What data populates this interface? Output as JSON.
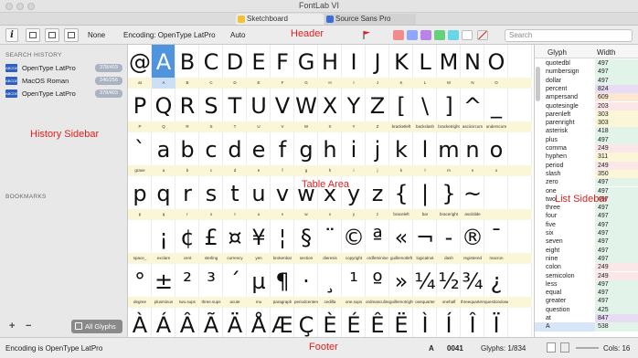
{
  "window": {
    "title": "FontLab VI"
  },
  "tabs": [
    {
      "label": "Sketchboard"
    },
    {
      "label": "Source Sans Pro"
    }
  ],
  "toolbar": {
    "info": "i",
    "none_label": "None",
    "encoding_label": "Encoding: OpenType LatPro",
    "auto_label": "Auto",
    "search_placeholder": "Search",
    "swatch_colors": [
      "#f28b8b",
      "#8fa6ff",
      "#b884e8",
      "#66d17a",
      "#66d6e8",
      "#ffffff"
    ]
  },
  "annotations": {
    "header": "Header",
    "history_sidebar": "History Sidebar",
    "table_area": "Table Area",
    "list_sidebar": "List Sidebar",
    "footer": "Footer"
  },
  "sidebar": {
    "search_history_title": "SEARCH HISTORY",
    "history": [
      {
        "icon": "ABCDE",
        "label": "OpenType LatPro",
        "badge": "378/403"
      },
      {
        "icon": "ABCDE",
        "label": "MacOS Roman",
        "badge": "246/256"
      },
      {
        "icon": "ABCDE",
        "label": "OpenType LatPro",
        "badge": "378/403"
      }
    ],
    "bookmarks_title": "BOOKMARKS",
    "plus": "+",
    "minus": "−",
    "all_glyphs": "All Glyphs"
  },
  "grid": {
    "rows": [
      {
        "cells": [
          {
            "g": "@",
            "n": "at"
          },
          {
            "g": "A",
            "n": "A"
          },
          {
            "g": "B",
            "n": "B"
          },
          {
            "g": "C",
            "n": "C"
          },
          {
            "g": "D",
            "n": "D"
          },
          {
            "g": "E",
            "n": "E"
          },
          {
            "g": "F",
            "n": "F"
          },
          {
            "g": "G",
            "n": "G"
          },
          {
            "g": "H",
            "n": "H"
          },
          {
            "g": "I",
            "n": "I"
          },
          {
            "g": "J",
            "n": "J"
          },
          {
            "g": "K",
            "n": "K"
          },
          {
            "g": "L",
            "n": "L"
          },
          {
            "g": "M",
            "n": "M"
          },
          {
            "g": "N",
            "n": "N"
          },
          {
            "g": "O",
            "n": "O"
          },
          {
            "g": "",
            "n": ""
          }
        ]
      },
      {
        "cells": [
          {
            "g": "P",
            "n": "P"
          },
          {
            "g": "Q",
            "n": "Q"
          },
          {
            "g": "R",
            "n": "R"
          },
          {
            "g": "S",
            "n": "S"
          },
          {
            "g": "T",
            "n": "T"
          },
          {
            "g": "U",
            "n": "U"
          },
          {
            "g": "V",
            "n": "V"
          },
          {
            "g": "W",
            "n": "W"
          },
          {
            "g": "X",
            "n": "X"
          },
          {
            "g": "Y",
            "n": "Y"
          },
          {
            "g": "Z",
            "n": "Z"
          },
          {
            "g": "[",
            "n": "bracketleft"
          },
          {
            "g": "\\",
            "n": "backslash"
          },
          {
            "g": "]",
            "n": "bracketright"
          },
          {
            "g": "^",
            "n": "asciicircum"
          },
          {
            "g": "_",
            "n": "underscore"
          },
          {
            "g": "",
            "n": ""
          }
        ]
      },
      {
        "cells": [
          {
            "g": "`",
            "n": "grave"
          },
          {
            "g": "a",
            "n": "a"
          },
          {
            "g": "b",
            "n": "b"
          },
          {
            "g": "c",
            "n": "c"
          },
          {
            "g": "d",
            "n": "d"
          },
          {
            "g": "e",
            "n": "e"
          },
          {
            "g": "f",
            "n": "f"
          },
          {
            "g": "g",
            "n": "g"
          },
          {
            "g": "h",
            "n": "h"
          },
          {
            "g": "i",
            "n": "i"
          },
          {
            "g": "j",
            "n": "j"
          },
          {
            "g": "k",
            "n": "k"
          },
          {
            "g": "l",
            "n": "l"
          },
          {
            "g": "m",
            "n": "m"
          },
          {
            "g": "n",
            "n": "n"
          },
          {
            "g": "o",
            "n": "o"
          },
          {
            "g": "",
            "n": ""
          }
        ]
      },
      {
        "cells": [
          {
            "g": "p",
            "n": "p"
          },
          {
            "g": "q",
            "n": "q"
          },
          {
            "g": "r",
            "n": "r"
          },
          {
            "g": "s",
            "n": "s"
          },
          {
            "g": "t",
            "n": "t"
          },
          {
            "g": "u",
            "n": "u"
          },
          {
            "g": "v",
            "n": "v"
          },
          {
            "g": "w",
            "n": "w"
          },
          {
            "g": "x",
            "n": "x"
          },
          {
            "g": "y",
            "n": "y"
          },
          {
            "g": "z",
            "n": "z"
          },
          {
            "g": "{",
            "n": "braceleft"
          },
          {
            "g": "|",
            "n": "bar"
          },
          {
            "g": "}",
            "n": "braceright"
          },
          {
            "g": "~",
            "n": "asciitilde"
          },
          {
            "g": "",
            "n": ""
          },
          {
            "g": "",
            "n": ""
          }
        ]
      },
      {
        "cells": [
          {
            "g": "",
            "n": "space_"
          },
          {
            "g": "¡",
            "n": "exclam"
          },
          {
            "g": "¢",
            "n": "cent"
          },
          {
            "g": "£",
            "n": "sterling"
          },
          {
            "g": "¤",
            "n": "currency"
          },
          {
            "g": "¥",
            "n": "yen"
          },
          {
            "g": "¦",
            "n": "brokenbar"
          },
          {
            "g": "§",
            "n": "section"
          },
          {
            "g": "¨",
            "n": "dieresis"
          },
          {
            "g": "©",
            "n": "copyright"
          },
          {
            "g": "ª",
            "n": "ordfeminine"
          },
          {
            "g": "«",
            "n": "guillemotleft"
          },
          {
            "g": "¬",
            "n": "logicalnot"
          },
          {
            "g": "-",
            "n": "dash"
          },
          {
            "g": "®",
            "n": "registered"
          },
          {
            "g": "¯",
            "n": "macron"
          },
          {
            "g": "",
            "n": ""
          }
        ]
      },
      {
        "cells": [
          {
            "g": "°",
            "n": "degree"
          },
          {
            "g": "±",
            "n": "plusminus"
          },
          {
            "g": "²",
            "n": "two.sups"
          },
          {
            "g": "³",
            "n": "three.sups"
          },
          {
            "g": "´",
            "n": "acute"
          },
          {
            "g": "µ",
            "n": "mu"
          },
          {
            "g": "¶",
            "n": "paragraph"
          },
          {
            "g": "·",
            "n": "periodcentered"
          },
          {
            "g": "¸",
            "n": "cedilla"
          },
          {
            "g": "¹",
            "n": "one.sups"
          },
          {
            "g": "º",
            "n": "ordmasculine"
          },
          {
            "g": "»",
            "n": "guillemotright"
          },
          {
            "g": "¼",
            "n": "onequarter"
          },
          {
            "g": "½",
            "n": "onehalf"
          },
          {
            "g": "¾",
            "n": "threequarters"
          },
          {
            "g": "¿",
            "n": "questiondown"
          },
          {
            "g": "",
            "n": ""
          }
        ]
      },
      {
        "cells": [
          {
            "g": "À",
            "n": ""
          },
          {
            "g": "Á",
            "n": ""
          },
          {
            "g": "Â",
            "n": ""
          },
          {
            "g": "Ã",
            "n": ""
          },
          {
            "g": "Ä",
            "n": ""
          },
          {
            "g": "Å",
            "n": ""
          },
          {
            "g": "Æ",
            "n": ""
          },
          {
            "g": "Ç",
            "n": ""
          },
          {
            "g": "È",
            "n": ""
          },
          {
            "g": "É",
            "n": ""
          },
          {
            "g": "Ê",
            "n": ""
          },
          {
            "g": "Ë",
            "n": ""
          },
          {
            "g": "Ì",
            "n": ""
          },
          {
            "g": "Í",
            "n": ""
          },
          {
            "g": "Î",
            "n": ""
          },
          {
            "g": "Ï",
            "n": ""
          },
          {
            "g": "",
            "n": ""
          }
        ]
      }
    ]
  },
  "list": {
    "header_glyph": "Glyph",
    "header_width": "Width",
    "rows": [
      {
        "name": "quotedbl",
        "width": "497",
        "color": "#e2f3ea"
      },
      {
        "name": "numbersign",
        "width": "497",
        "color": "#e2f3ea"
      },
      {
        "name": "dollar",
        "width": "497",
        "color": "#e2f3ea"
      },
      {
        "name": "percent",
        "width": "824",
        "color": "#e7dcf4"
      },
      {
        "name": "ampersand",
        "width": "609",
        "color": "#fbe7d3"
      },
      {
        "name": "quotesingle",
        "width": "203",
        "color": "#fbe7e7"
      },
      {
        "name": "parenleft",
        "width": "303",
        "color": "#fbf6d8"
      },
      {
        "name": "parenright",
        "width": "303",
        "color": "#fbf6d8"
      },
      {
        "name": "asterisk",
        "width": "418",
        "color": "#e2f3ea"
      },
      {
        "name": "plus",
        "width": "497",
        "color": "#e2f3ea"
      },
      {
        "name": "comma",
        "width": "249",
        "color": "#fbe7e7"
      },
      {
        "name": "hyphen",
        "width": "311",
        "color": "#fbf6d8"
      },
      {
        "name": "period",
        "width": "249",
        "color": "#fbe7e7"
      },
      {
        "name": "slash",
        "width": "350",
        "color": "#fbf6d8"
      },
      {
        "name": "zero",
        "width": "497",
        "color": "#e2f3ea"
      },
      {
        "name": "one",
        "width": "497",
        "color": "#e2f3ea"
      },
      {
        "name": "two",
        "width": "497",
        "color": "#e2f3ea"
      },
      {
        "name": "three",
        "width": "497",
        "color": "#e2f3ea"
      },
      {
        "name": "four",
        "width": "497",
        "color": "#e2f3ea"
      },
      {
        "name": "five",
        "width": "497",
        "color": "#e2f3ea"
      },
      {
        "name": "six",
        "width": "497",
        "color": "#e2f3ea"
      },
      {
        "name": "seven",
        "width": "497",
        "color": "#e2f3ea"
      },
      {
        "name": "eight",
        "width": "497",
        "color": "#e2f3ea"
      },
      {
        "name": "nine",
        "width": "497",
        "color": "#e2f3ea"
      },
      {
        "name": "colon",
        "width": "249",
        "color": "#fbe7e7"
      },
      {
        "name": "semicolon",
        "width": "249",
        "color": "#fbe7e7"
      },
      {
        "name": "less",
        "width": "497",
        "color": "#e2f3ea"
      },
      {
        "name": "equal",
        "width": "497",
        "color": "#e2f3ea"
      },
      {
        "name": "greater",
        "width": "497",
        "color": "#e2f3ea"
      },
      {
        "name": "question",
        "width": "425",
        "color": "#e2f3ea"
      },
      {
        "name": "at",
        "width": "847",
        "color": "#e7dcf4"
      },
      {
        "name": "A",
        "width": "538",
        "color": "#e2f3ea"
      }
    ]
  },
  "footer": {
    "encoding": "Encoding is OpenType LatPro",
    "glyph": "A",
    "code": "0041",
    "glyphs": "Glyphs: 1/834",
    "cols": "Cols: 16"
  }
}
